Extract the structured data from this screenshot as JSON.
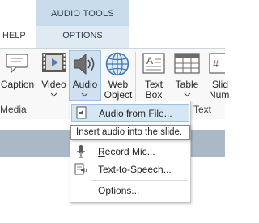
{
  "ribbon": {
    "contextual_tab_group": "AUDIO TOOLS",
    "tabs": {
      "help": "HELP",
      "options": "OPTIONS"
    },
    "buttons": {
      "caption": "Caption",
      "video": "Video",
      "audio": "Audio",
      "web_object_line1": "Web",
      "web_object_line2": "Object",
      "text_box_line1": "Text",
      "text_box_line2": "Box",
      "table": "Table",
      "slide_number_line1": "Slid",
      "slide_number_line2": "Num"
    },
    "groups": {
      "media": "Media",
      "text": "Text"
    }
  },
  "audio_menu": {
    "items": [
      {
        "label_pre": "Audio from ",
        "label_u": "F",
        "label_post": "ile...",
        "icon": "audio-file-icon",
        "highlighted": true
      },
      {
        "label_pre": "",
        "label_u": "R",
        "label_post": "ecord Mic...",
        "icon": "microphone-icon",
        "highlighted": false
      },
      {
        "label_pre": "Text-to-Speech...",
        "label_u": "",
        "label_post": "",
        "icon": "text-to-speech-icon",
        "highlighted": false
      },
      {
        "label_pre": "",
        "label_u": "O",
        "label_post": "ptions...",
        "icon": "",
        "highlighted": false
      }
    ],
    "tooltip": "Insert audio into the slide."
  }
}
